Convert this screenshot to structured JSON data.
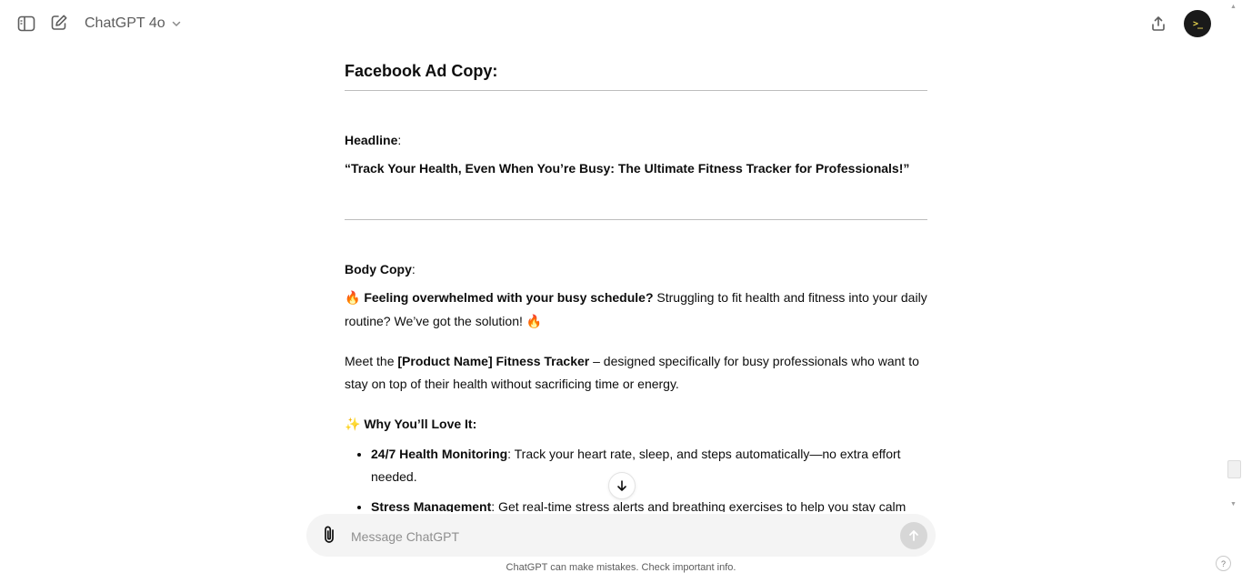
{
  "header": {
    "model_name": "ChatGPT 4o",
    "avatar_text": ">_"
  },
  "message": {
    "section_title": "Facebook Ad Copy:",
    "headline_label": "Headline",
    "headline_colon": ":",
    "headline_text": "“Track Your Health, Even When You’re Busy: The Ultimate Fitness Tracker for Professionals!”",
    "body_label": "Body Copy",
    "body_colon": ":",
    "p1_emoji": "🔥",
    "p1_bold": "Feeling overwhelmed with your busy schedule?",
    "p1_rest": " Struggling to fit health and fitness into your daily routine? We’ve got the solution! ",
    "p1_emoji_end": "🔥",
    "p2_start": "Meet the ",
    "p2_bold": "[Product Name] Fitness Tracker",
    "p2_rest": " – designed specifically for busy professionals who want to stay on top of their health without sacrificing time or energy.",
    "why_emoji": "✨",
    "why_label": "Why You’ll Love It:",
    "bullets": [
      {
        "bold": "24/7 Health Monitoring",
        "text": ": Track your heart rate, sleep, and steps automatically—no extra effort needed."
      },
      {
        "bold": "Stress Management",
        "text": ": Get real-time stress alerts and breathing exercises to help you stay calm"
      }
    ]
  },
  "composer": {
    "placeholder": "Message ChatGPT"
  },
  "footer": {
    "disclaimer": "ChatGPT can make mistakes. Check important info.",
    "help": "?"
  }
}
